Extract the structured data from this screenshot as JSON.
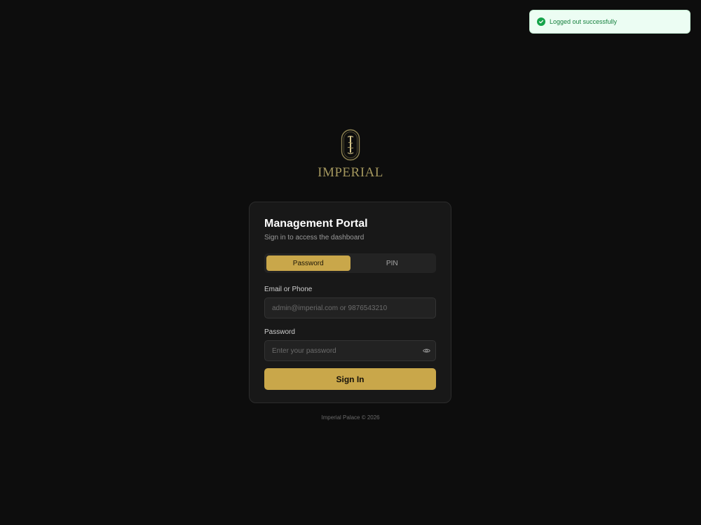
{
  "toast": {
    "icon": "check-circle-icon",
    "message": "Logged out successfully",
    "color": "#15803d"
  },
  "brand": {
    "wordmark": "IMPERIAL",
    "emblem_icon": "imperial-emblem-icon",
    "color": "#a3965d"
  },
  "login": {
    "title": "Management Portal",
    "subtitle": "Sign in to access the dashboard",
    "tabs": [
      {
        "label": "Password",
        "active": true
      },
      {
        "label": "PIN",
        "active": false
      }
    ],
    "email": {
      "label": "Email or Phone",
      "placeholder": "admin@imperial.com or 9876543210",
      "value": ""
    },
    "password": {
      "label": "Password",
      "placeholder": "Enter your password",
      "value": "",
      "toggle_icon": "eye-icon"
    },
    "submit_label": "Sign In",
    "accent_color": "#c9a74a"
  },
  "footer": {
    "text": "Imperial Palace © 2026"
  }
}
